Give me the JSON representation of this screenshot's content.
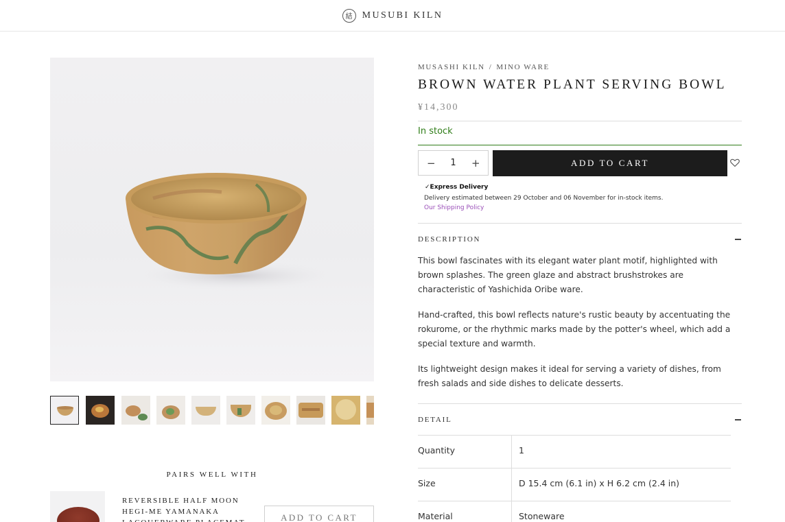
{
  "header": {
    "brand": "MUSUBI KILN",
    "logo_glyph": "結"
  },
  "product": {
    "breadcrumb": [
      "MUSASHI KILN",
      "MINO WARE"
    ],
    "breadcrumb_sep": "/",
    "title": "BROWN WATER PLANT SERVING BOWL",
    "price": "¥14,300",
    "stock": "In stock",
    "quantity": "1",
    "qty_minus": "−",
    "qty_plus": "+",
    "add_to_cart": "ADD TO CART",
    "wishlist_icon": "heart-icon"
  },
  "delivery": {
    "express": "✓Express Delivery",
    "estimate": "Delivery estimated between 29 October and 06 November for in-stock items.",
    "policy_link": "Our Shipping Policy"
  },
  "description": {
    "label": "DESCRIPTION",
    "p1": "This bowl fascinates with its elegant water plant motif, highlighted with brown splashes. The green glaze and abstract brushstrokes are characteristic of Yashichida Oribe ware.",
    "p2_pre": "Hand-crafted, this bowl reflects nature's rustic beauty by accentuating the ",
    "p2_em": "rokurome",
    "p2_post": ", or the rhythmic marks made by the potter's wheel, which add a special texture and warmth.",
    "p3": "Its lightweight design makes it ideal for serving a variety of dishes, from fresh salads and side dishes to delicate desserts."
  },
  "detail": {
    "label": "DETAIL",
    "rows": [
      {
        "key": "Quantity",
        "value": "1"
      },
      {
        "key": "Size",
        "value": "D 15.4 cm (6.1 in) x H 6.2 cm (2.4 in)"
      },
      {
        "key": "Material",
        "value": "Stoneware"
      }
    ]
  },
  "pairs": {
    "title": "PAIRS WELL WITH",
    "item_name": "REVERSIBLE HALF MOON HEGI-ME YAMANAKA LACQUERWARE PLACEMAT",
    "add_to_cart": "ADD TO CART"
  },
  "colors": {
    "accent_dark": "#1c1c1c",
    "stock_green": "#2f7d18",
    "link_purple": "#9a4fb8"
  }
}
